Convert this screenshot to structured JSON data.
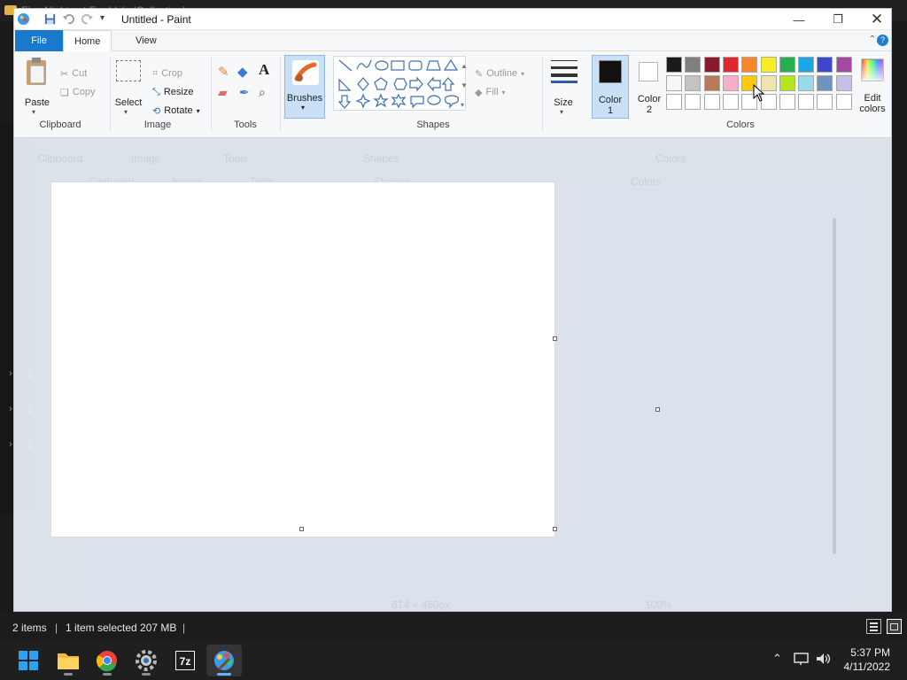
{
  "background": {
    "explorer_title": "Five Nights at Freddy's (Collection)",
    "status_items": "2 items",
    "status_selected": "1 item selected  207 MB"
  },
  "paint": {
    "title": "Untitled - Paint",
    "tabs": {
      "file": "File",
      "home": "Home",
      "view": "View"
    },
    "clipboard": {
      "paste": "Paste",
      "cut": "Cut",
      "copy": "Copy",
      "label": "Clipboard"
    },
    "image": {
      "select": "Select",
      "crop": "Crop",
      "resize": "Resize",
      "rotate": "Rotate",
      "label": "Image"
    },
    "tools": {
      "label": "Tools"
    },
    "brushes": {
      "label": "Brushes"
    },
    "shapes": {
      "outline": "Outline",
      "fill": "Fill",
      "label": "Shapes"
    },
    "size": {
      "label": "Size"
    },
    "color1": {
      "label_line1": "Color",
      "label_line2": "1",
      "value": "#111111"
    },
    "color2": {
      "label_line1": "Color",
      "label_line2": "2",
      "value": "#ffffff"
    },
    "colors": {
      "label": "Colors",
      "edit_line1": "Edit",
      "edit_line2": "colors"
    },
    "palette_row1": [
      "#1b1b1b",
      "#7f7f7f",
      "#8a1a2b",
      "#e0272f",
      "#f8862b",
      "#f6ee22",
      "#25b04d",
      "#1aa7e6",
      "#3f48cc",
      "#a349a4"
    ],
    "palette_row2": [
      "#f6f6f6",
      "#c3c3c3",
      "#b97a57",
      "#f7aec9",
      "#fdc90f",
      "#efe4b0",
      "#b5e61d",
      "#99d9ea",
      "#7092be",
      "#c8bfe7"
    ],
    "palette_row3": [
      "#ffffff",
      "#ffffff",
      "#ffffff",
      "#ffffff",
      "#ffffff",
      "#ffffff",
      "#ffffff",
      "#ffffff",
      "#ffffff",
      "#ffffff"
    ],
    "ghost": {
      "title": "Untitled - Paint",
      "groups": [
        "Clipboard",
        "Image",
        "Tools",
        "Shapes",
        "Colors"
      ],
      "dimensions": "614 × 460px",
      "zoom": "100%"
    }
  },
  "taskbar": {
    "apps": [
      {
        "name": "Start",
        "icon": "windows-logo"
      },
      {
        "name": "File Explorer",
        "icon": "folder"
      },
      {
        "name": "Google Chrome",
        "icon": "chrome"
      },
      {
        "name": "Settings",
        "icon": "gear"
      },
      {
        "name": "7-Zip",
        "icon": "7z"
      },
      {
        "name": "Paint",
        "icon": "paint-palette"
      }
    ],
    "seven_zip_label": "7z",
    "time": "5:37 PM",
    "date": "4/11/2022"
  }
}
